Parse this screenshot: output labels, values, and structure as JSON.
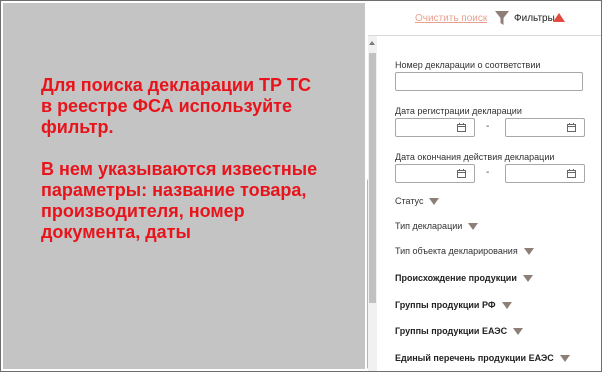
{
  "overlay": {
    "note": "Для поиска декларации ТР ТС\nв реестре ФСА используйте\nфильтр.\n\nВ нем указываются известные\nпараметры: название товара,\nпроизводителя, номер\nдокумента, даты"
  },
  "toolbar": {
    "clear_search": "Очистить поиск",
    "filters_label": "Фильтры"
  },
  "filters": {
    "declaration_number": {
      "label": "Номер декларации о соответствии",
      "value": "",
      "placeholder": ""
    },
    "registration_date": {
      "label": "Дата регистрации декларации",
      "separator": "-"
    },
    "expiration_date": {
      "label": "Дата окончания действия декларации",
      "separator": "-"
    },
    "status": "Статус",
    "declaration_type": "Тип декларации",
    "object_type": "Тип объекта декларирования",
    "origin": "Происхождение продукции",
    "groups_rf": "Группы продукции РФ",
    "groups_eaeu": "Группы продукции ЕАЭС",
    "single_list_eaeu": "Единый перечень продукции ЕАЭС"
  },
  "colors": {
    "accent": "#e44a3f",
    "note_text": "#e8141c",
    "overlay": "#c4c4c4",
    "dropdown_arrow": "#8d7f77"
  }
}
